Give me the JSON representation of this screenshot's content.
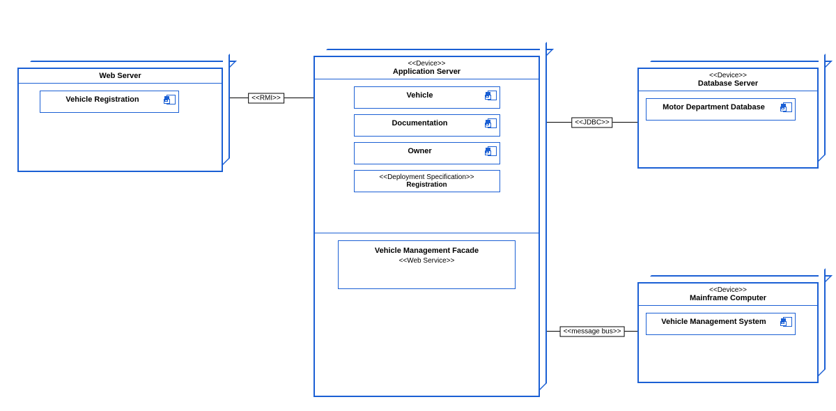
{
  "nodes": {
    "web_server": {
      "title": "Web Server",
      "components": [
        "Vehicle Registration"
      ]
    },
    "app_server": {
      "stereotype": "<<Device>>",
      "title": "Application Server",
      "components": [
        "Vehicle",
        "Documentation",
        "Owner"
      ],
      "spec": {
        "stereotype": "<<Deployment Specification>>",
        "name": "Registration"
      },
      "service": {
        "name": "Vehicle Management Facade",
        "stereotype": "<<Web Service>>"
      }
    },
    "db_server": {
      "stereotype": "<<Device>>",
      "title": "Database Server",
      "components": [
        "Motor Department Database"
      ]
    },
    "mainframe": {
      "stereotype": "<<Device>>",
      "title": "Mainframe Computer",
      "components": [
        "Vehicle Management System"
      ]
    }
  },
  "connectors": {
    "rmi": "<<RMI>>",
    "jdbc": "<<JDBC>>",
    "msgbus": "<<message bus>>"
  }
}
